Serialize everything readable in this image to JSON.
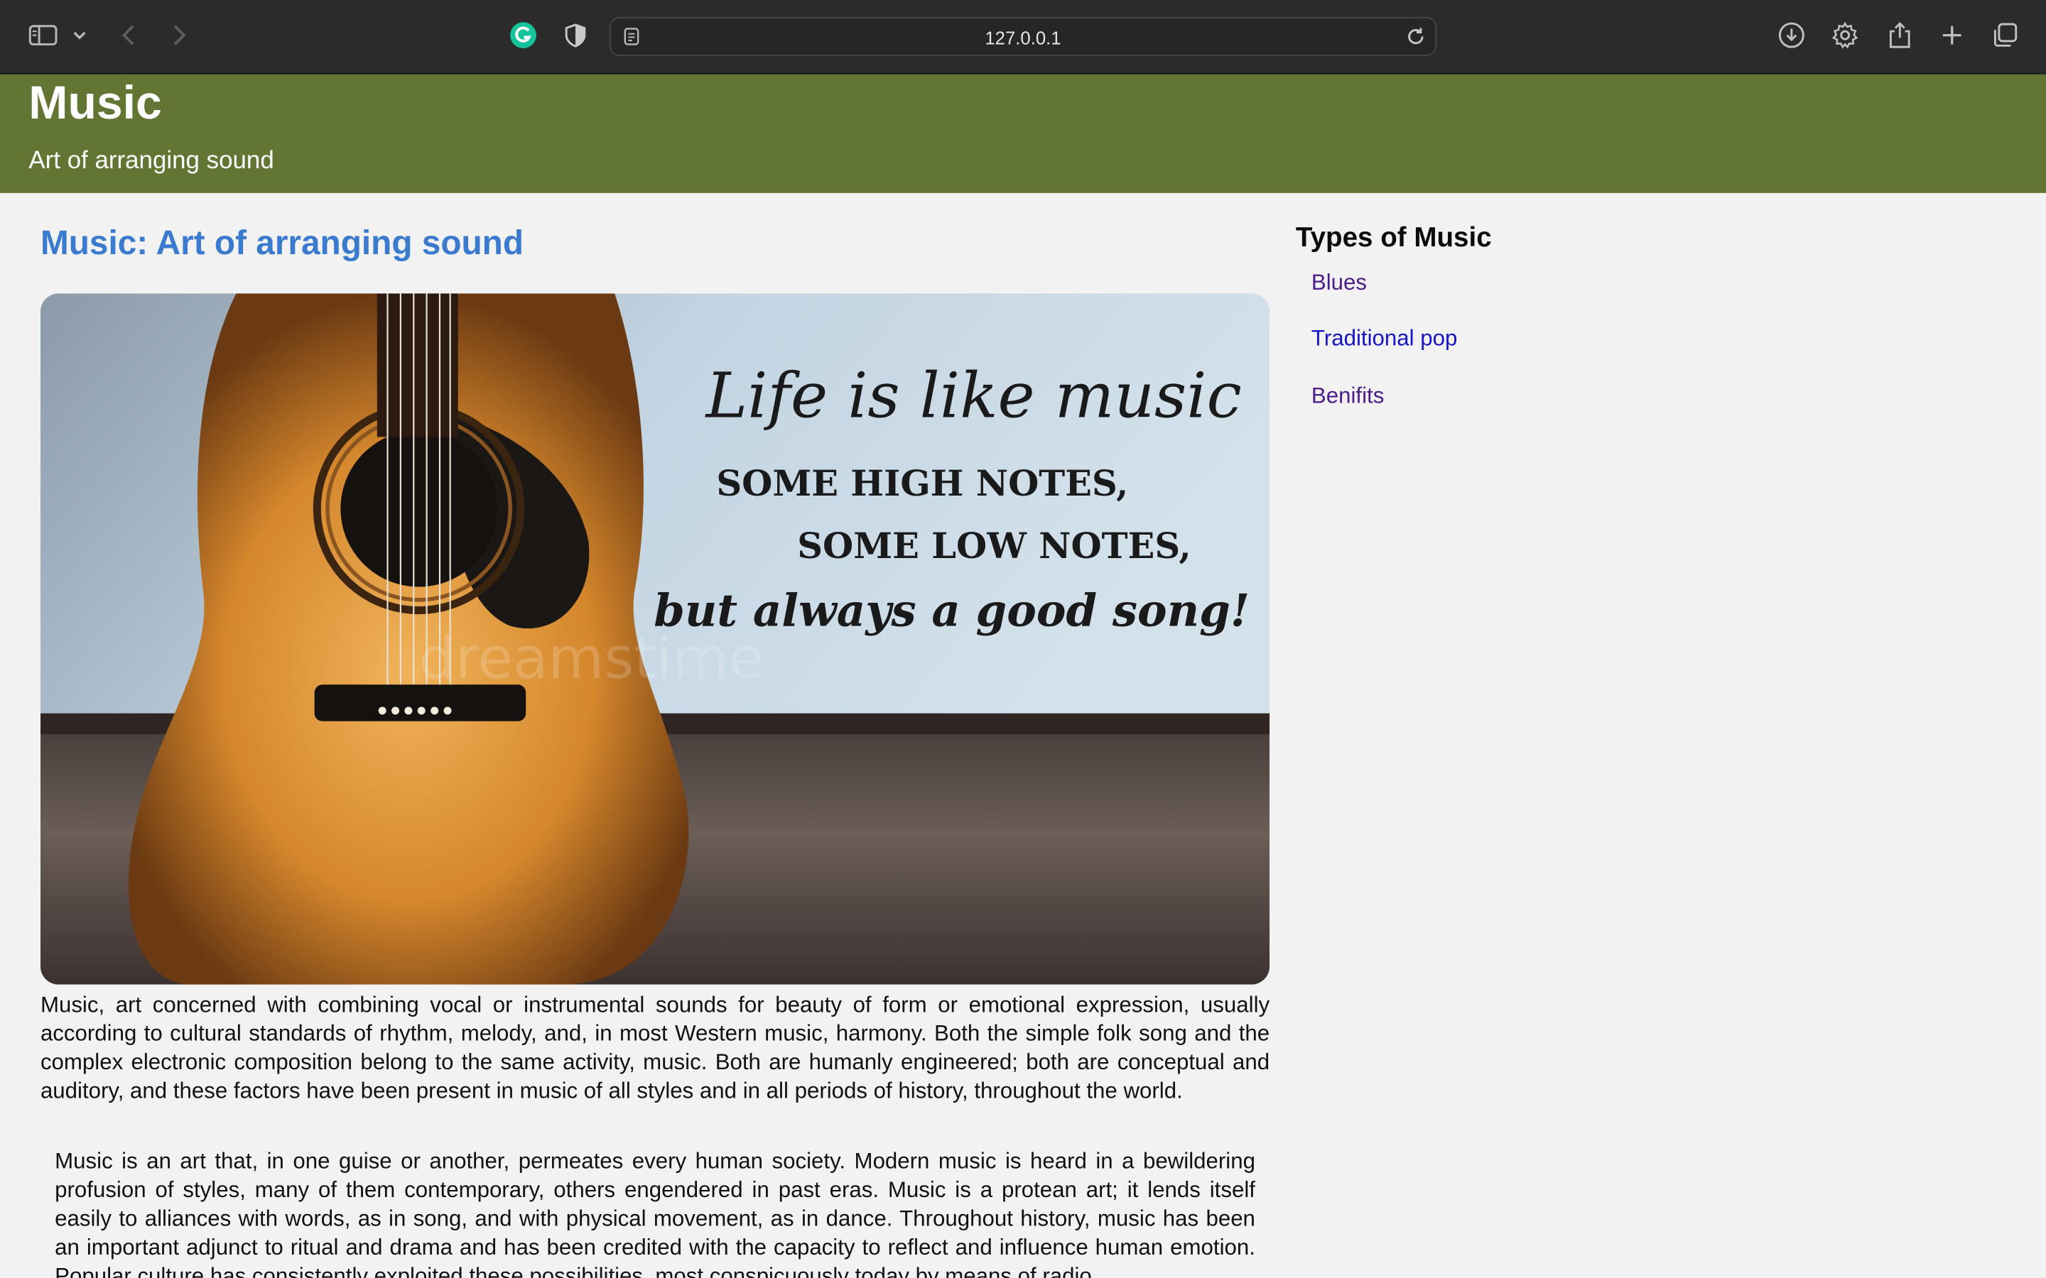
{
  "browser": {
    "url": "127.0.0.1"
  },
  "header": {
    "title": "Music",
    "subtitle": "Art of arranging sound"
  },
  "main": {
    "heading": "Music: Art of arranging sound",
    "hero_image": {
      "quote_script": "Life is like music",
      "quote_line1": "SOME HIGH NOTES,",
      "quote_line2": "SOME LOW NOTES,",
      "quote_line3": "but always a good song!",
      "watermark": "dreamstime"
    },
    "paragraphs": [
      "Music, art concerned with combining vocal or instrumental sounds for beauty of form or emotional expression, usually according to cultural standards of rhythm, melody, and, in most Western music, harmony. Both the simple folk song and the complex electronic composition belong to the same activity, music. Both are humanly engineered; both are conceptual and auditory, and these factors have been present in music of all styles and in all periods of history, throughout the world.",
      "Music is an art that, in one guise or another, permeates every human society. Modern music is heard in a bewildering profusion of styles, many of them contemporary, others engendered in past eras. Music is a protean art; it lends itself easily to alliances with words, as in song, and with physical movement, as in dance. Throughout history, music has been an important adjunct to ritual and drama and has been credited with the capacity to reflect and influence human emotion. Popular culture has consistently exploited these possibilities, most conspicuously today by means of radio,"
    ]
  },
  "sidebar": {
    "title": "Types of Music",
    "links": [
      {
        "label": "Blues"
      },
      {
        "label": "Traditional pop"
      },
      {
        "label": "Benifits"
      }
    ]
  },
  "colors": {
    "header_bg": "#627532",
    "heading_blue": "#3a7bd0",
    "visited_link": "#4b1c8a",
    "link": "#1616c8"
  }
}
